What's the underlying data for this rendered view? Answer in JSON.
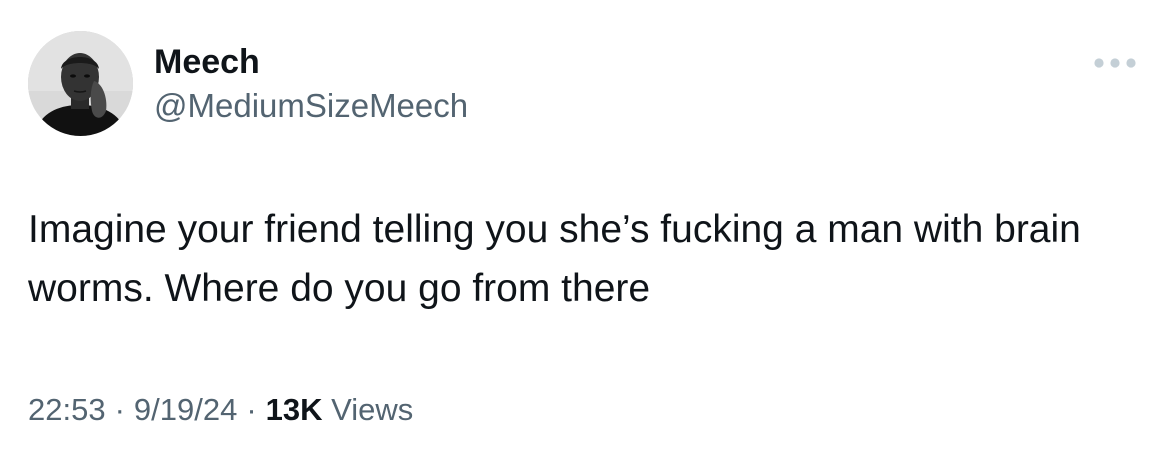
{
  "author": {
    "display_name": "Meech",
    "handle": "@MediumSizeMeech",
    "avatar_icon": "user-avatar-photo"
  },
  "more_icon": "more-horizontal-icon",
  "tweet": {
    "text": "Imagine your friend telling you she’s fucking a man with brain worms. Where do you go from there"
  },
  "meta": {
    "time": "22:53",
    "separator": "·",
    "date": "9/19/24",
    "views_count": "13K",
    "views_label": "Views"
  },
  "colors": {
    "primary_text": "#0f1419",
    "secondary_text": "#536471",
    "more_icon": "#c4cfd6",
    "background": "#ffffff"
  }
}
